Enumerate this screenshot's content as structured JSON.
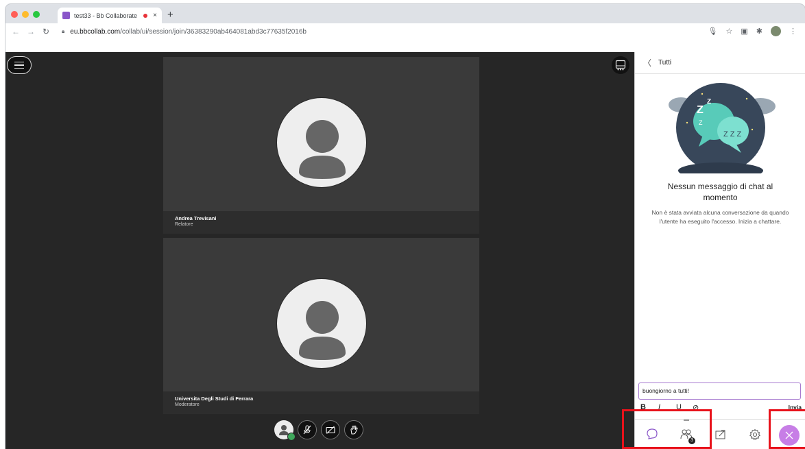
{
  "browser": {
    "tab_title": "test33 - Bb Collaborate",
    "tab_close": "×",
    "new_tab": "+",
    "url_host": "eu.bbcollab.com",
    "url_path": "/collab/ui/session/join/36383290ab464081abd3c77635f2016b"
  },
  "session": {
    "tiles": [
      {
        "name": "Andrea Trevisani",
        "role": "Relatore"
      },
      {
        "name": "Universita Degli Studi di Ferrara",
        "role": "Moderatore"
      }
    ]
  },
  "chat_panel": {
    "back_label": "Tutti",
    "empty_title": "Nessun messaggio di chat al momento",
    "empty_description": "Non è stata avviata alcuna conversazione da quando l'utente ha eseguito l'accesso. Inizia a chattare.",
    "compose_value": "buongiorno a tutti!",
    "format_bold": "B",
    "format_italic": "I",
    "format_underline": "U",
    "format_link": "⊘",
    "send_label": "Invia",
    "participants_count": "3"
  },
  "icons": {
    "menu": "hamburger-menu-icon",
    "layout": "layout-toggle-icon",
    "chat": "chat-bubble-icon",
    "attendees": "attendees-icon",
    "share": "share-content-icon",
    "settings": "gear-icon",
    "close": "close-icon"
  },
  "colors": {
    "accent": "#8a56c9",
    "close_button": "#c77ee6",
    "highlight": "#e8121b",
    "stage_bg": "#262626"
  }
}
